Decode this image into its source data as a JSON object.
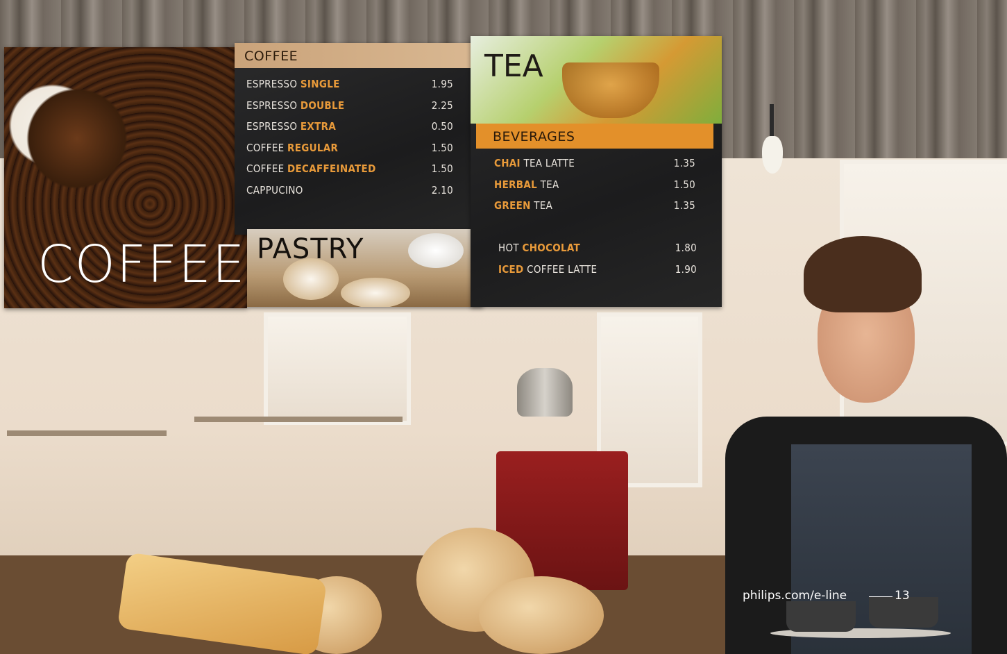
{
  "coffee_panel": {
    "title": "COFFEE"
  },
  "coffee_menu": {
    "heading": "COFFEE",
    "items": [
      {
        "prefix": "ESPRESSO ",
        "highlight": "SINGLE",
        "suffix": "",
        "price": "1.95"
      },
      {
        "prefix": "ESPRESSO ",
        "highlight": "DOUBLE",
        "suffix": "",
        "price": "2.25"
      },
      {
        "prefix": "ESPRESSO ",
        "highlight": "EXTRA",
        "suffix": "",
        "price": "0.50"
      },
      {
        "prefix": "COFFEE ",
        "highlight": "REGULAR",
        "suffix": "",
        "price": "1.50"
      },
      {
        "prefix": "COFFEE ",
        "highlight": "DECAFFEINATED",
        "suffix": "",
        "price": "1.50"
      },
      {
        "prefix": "CAPPUCINO",
        "highlight": "",
        "suffix": "",
        "price": "2.10"
      }
    ]
  },
  "pastry_panel": {
    "title": "PASTRY"
  },
  "tea_panel": {
    "title": "TEA"
  },
  "beverages_menu": {
    "heading": "BEVERAGES",
    "items": [
      {
        "prefix": "",
        "highlight": "CHAI",
        "suffix": " TEA LATTE",
        "price": "1.35"
      },
      {
        "prefix": "",
        "highlight": "HERBAL",
        "suffix": " TEA",
        "price": "1.50"
      },
      {
        "prefix": "",
        "highlight": "GREEN",
        "suffix": " TEA",
        "price": "1.35"
      }
    ],
    "items2": [
      {
        "prefix": "HOT ",
        "highlight": "CHOCOLAT",
        "suffix": "",
        "price": "1.80"
      },
      {
        "prefix": "",
        "highlight": "ICED",
        "suffix": " COFFEE LATTE",
        "price": "1.90"
      }
    ]
  },
  "footer": {
    "url": "philips.com/e-line",
    "page_number": "13"
  },
  "colors": {
    "accent_orange": "#e89a3a",
    "band_orange": "#e3902a",
    "band_tan": "#caa37a",
    "panel_dark": "#1f1f20"
  }
}
